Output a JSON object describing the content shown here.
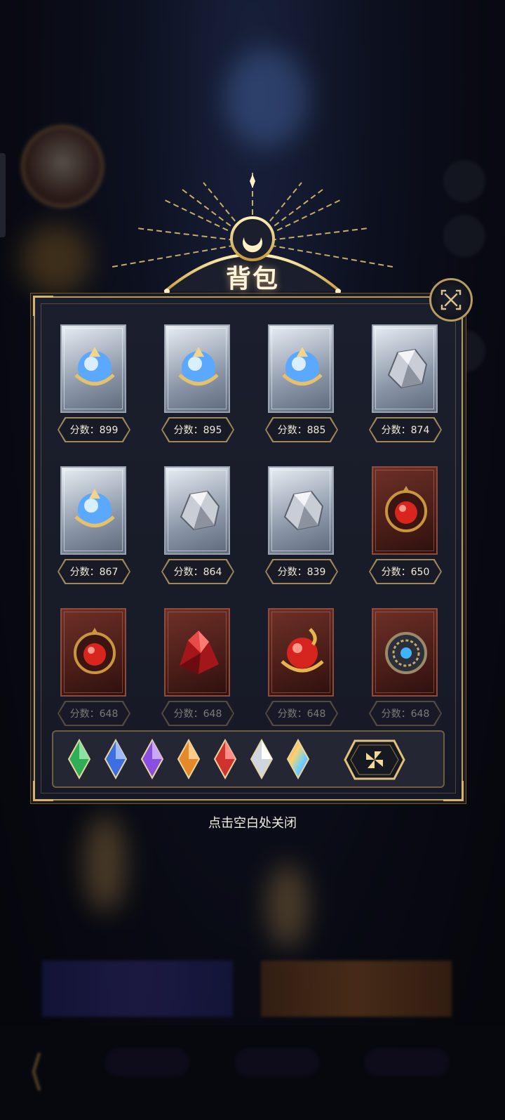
{
  "panel": {
    "title": "背包",
    "close_hint": "点击空白处关闭"
  },
  "items": [
    {
      "score_label": "分数：899",
      "kind": "crystal-orb",
      "rarity": "silver"
    },
    {
      "score_label": "分数：895",
      "kind": "crystal-orb",
      "rarity": "silver"
    },
    {
      "score_label": "分数：885",
      "kind": "crystal-orb",
      "rarity": "silver"
    },
    {
      "score_label": "分数：874",
      "kind": "silver-ore",
      "rarity": "silver"
    },
    {
      "score_label": "分数：867",
      "kind": "crystal-orb",
      "rarity": "silver"
    },
    {
      "score_label": "分数：864",
      "kind": "silver-ore",
      "rarity": "silver"
    },
    {
      "score_label": "分数：839",
      "kind": "silver-ore",
      "rarity": "silver"
    },
    {
      "score_label": "分数：650",
      "kind": "ruby-amulet",
      "rarity": "red"
    },
    {
      "score_label": "分数：648",
      "kind": "ruby-amulet",
      "rarity": "red"
    },
    {
      "score_label": "分数：648",
      "kind": "ruby-cluster",
      "rarity": "red"
    },
    {
      "score_label": "分数：648",
      "kind": "ruby-orb",
      "rarity": "red"
    },
    {
      "score_label": "分数：648",
      "kind": "sapphire-medallion",
      "rarity": "red"
    }
  ],
  "gem_filters": [
    {
      "name": "green-gem-icon",
      "color": "#2fae57"
    },
    {
      "name": "blue-gem-icon",
      "color": "#3d6fe0"
    },
    {
      "name": "purple-gem-icon",
      "color": "#8a4ee0"
    },
    {
      "name": "orange-gem-icon",
      "color": "#e58a2a"
    },
    {
      "name": "red-gem-icon",
      "color": "#d2322e"
    },
    {
      "name": "white-gem-icon",
      "color": "#e8edf3"
    },
    {
      "name": "rainbow-gem-icon",
      "color": "#d86ad8"
    }
  ],
  "colors": {
    "gold": "#b79b5f",
    "panel": "#1b1f2d"
  }
}
